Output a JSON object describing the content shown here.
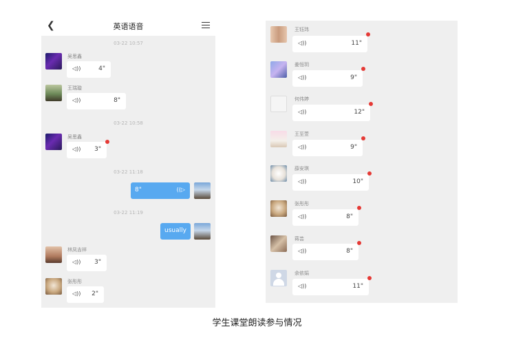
{
  "header": {
    "title": "英语语音",
    "back_icon": "chevron-left-icon",
    "menu_icon": "hamburger-menu-icon"
  },
  "colors": {
    "panel_bg": "#efefef",
    "self_bubble": "#58a9f0",
    "unread_dot": "#e53935"
  },
  "left": {
    "timestamps": [
      "03-22 10:57",
      "03-22 10:58",
      "03-22 11:18",
      "03-22 11:19"
    ],
    "messages": [
      {
        "name": "吴思鑫",
        "duration": "4\""
      },
      {
        "name": "王瑞璇",
        "duration": "8\""
      },
      {
        "name": "吴思鑫",
        "duration": "3\""
      },
      {
        "self_duration": "8\""
      },
      {
        "self_text": "usually"
      },
      {
        "name": "林凤吉祥",
        "duration": "3\""
      },
      {
        "name": "张彤彤",
        "duration": "2\""
      }
    ]
  },
  "right": {
    "messages": [
      {
        "name": "王钰玮",
        "duration": "11\""
      },
      {
        "name": "姜恒玥",
        "duration": "9\""
      },
      {
        "name": "何伟婷",
        "duration": "12\""
      },
      {
        "name": "王至萱",
        "duration": "9\""
      },
      {
        "name": "薛安琪",
        "duration": "10\""
      },
      {
        "name": "张彤彤",
        "duration": "8\""
      },
      {
        "name": "蒋芸",
        "duration": "8\""
      },
      {
        "name": "余依娟",
        "duration": "11\""
      }
    ]
  },
  "caption": "学生课堂朗读参与情况"
}
